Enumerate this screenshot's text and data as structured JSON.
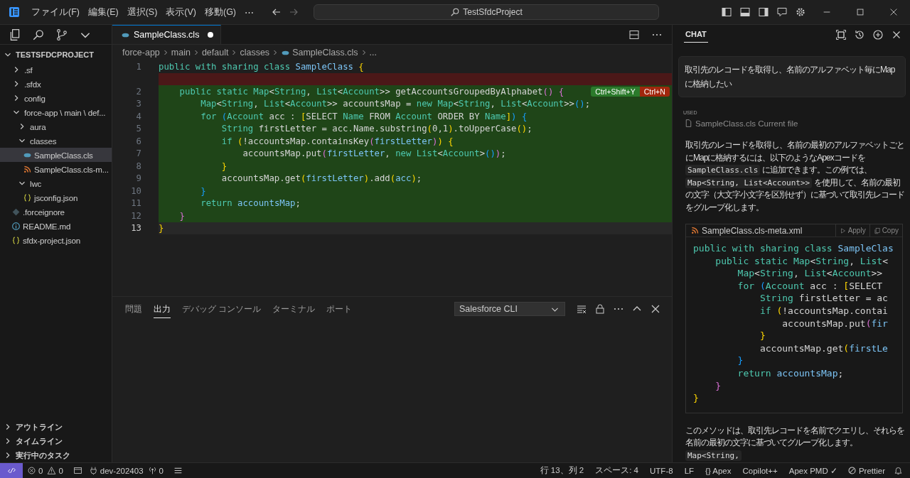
{
  "titlebar": {
    "menus": [
      "ファイル(F)",
      "編集(E)",
      "選択(S)",
      "表示(V)",
      "移動(G)"
    ],
    "overflow": "⋯",
    "search": "TestSfdcProject"
  },
  "explorer": {
    "title": "TESTSFDCPROJECT",
    "items": [
      {
        "label": ".sf",
        "kind": "folder",
        "expanded": false,
        "selected": false
      },
      {
        "label": ".sfdx",
        "kind": "folder",
        "expanded": false,
        "selected": false
      },
      {
        "label": "config",
        "kind": "folder",
        "expanded": false,
        "selected": false
      },
      {
        "label": "force-app \\ main \\ def...",
        "kind": "folder",
        "expanded": true,
        "selected": false,
        "children": [
          {
            "label": "aura",
            "kind": "folder",
            "expanded": false,
            "selected": false
          },
          {
            "label": "classes",
            "kind": "folder",
            "expanded": true,
            "selected": false,
            "children": [
              {
                "label": "SampleClass.cls",
                "kind": "apex",
                "selected": true
              },
              {
                "label": "SampleClass.cls-m...",
                "kind": "xml",
                "selected": false
              }
            ]
          },
          {
            "label": "lwc",
            "kind": "folder",
            "expanded": true,
            "selected": false,
            "children": [
              {
                "label": "jsconfig.json",
                "kind": "json",
                "selected": false
              }
            ]
          }
        ]
      },
      {
        "label": ".forceignore",
        "kind": "ignore",
        "selected": false
      },
      {
        "label": "README.md",
        "kind": "info",
        "selected": false
      },
      {
        "label": "sfdx-project.json",
        "kind": "json",
        "selected": false
      }
    ],
    "sections": [
      "アウトライン",
      "タイムライン",
      "実行中のタスク"
    ]
  },
  "editor": {
    "tabs": [
      {
        "label": "SampleClass.cls",
        "selected": true,
        "modified": true
      }
    ],
    "breadcrumbs": [
      {
        "label": "force-app",
        "kind": "folder"
      },
      {
        "label": "main",
        "kind": "folder"
      },
      {
        "label": "default",
        "kind": "folder"
      },
      {
        "label": "classes",
        "kind": "folder"
      },
      {
        "label": "SampleClass.cls",
        "kind": "apex"
      },
      {
        "label": "...",
        "kind": "more"
      }
    ],
    "lines": [
      {
        "number": "1",
        "kind": "context",
        "tokens": [
          {
            "text": "public with sharing class ",
            "kind": "keyword"
          },
          {
            "text": "SampleClass",
            "kind": "variable"
          },
          {
            "text": " {",
            "kind": "bracket1"
          }
        ]
      },
      {
        "kind": "removed"
      },
      {
        "number": "2",
        "kind": "added",
        "tokens": [
          {
            "text": "    public static Map",
            "kind": "keyword"
          },
          {
            "text": "<"
          },
          {
            "text": "String",
            "kind": "keyword"
          },
          {
            "text": ", "
          },
          {
            "text": "List",
            "kind": "keyword"
          },
          {
            "text": "<"
          },
          {
            "text": "Account",
            "kind": "keyword"
          },
          {
            "text": ">> getAccountsGroupedByAlphabet"
          },
          {
            "text": "()",
            "kind": "bracket2"
          },
          {
            "text": " {",
            "kind": "bracket2"
          }
        ],
        "actions": [
          {
            "label": "Ctrl+Shift+Y",
            "kind": "accept"
          },
          {
            "label": "Ctrl+N",
            "kind": "reject"
          }
        ]
      },
      {
        "number": "3",
        "kind": "added",
        "tokens": [
          {
            "text": "        Map",
            "kind": "keyword"
          },
          {
            "text": "<"
          },
          {
            "text": "String",
            "kind": "keyword"
          },
          {
            "text": ", "
          },
          {
            "text": "List",
            "kind": "keyword"
          },
          {
            "text": "<"
          },
          {
            "text": "Account",
            "kind": "keyword"
          },
          {
            "text": ">> accountsMap = "
          },
          {
            "text": "new Map",
            "kind": "keyword"
          },
          {
            "text": "<"
          },
          {
            "text": "String",
            "kind": "keyword"
          },
          {
            "text": ", "
          },
          {
            "text": "List",
            "kind": "keyword"
          },
          {
            "text": "<"
          },
          {
            "text": "Account",
            "kind": "keyword"
          },
          {
            "text": ">>"
          },
          {
            "text": "()",
            "kind": "bracket3"
          },
          {
            "text": ";"
          }
        ]
      },
      {
        "number": "4",
        "kind": "added",
        "tokens": [
          {
            "text": "        for ",
            "kind": "keyword"
          },
          {
            "text": "(",
            "kind": "bracket3"
          },
          {
            "text": "Account",
            "kind": "keyword"
          },
          {
            "text": " acc : "
          },
          {
            "text": "[",
            "kind": "bracket1"
          },
          {
            "text": "SELECT "
          },
          {
            "text": "Name",
            "kind": "keyword"
          },
          {
            "text": " FROM "
          },
          {
            "text": "Account",
            "kind": "keyword"
          },
          {
            "text": " ORDER BY "
          },
          {
            "text": "Name",
            "kind": "keyword"
          },
          {
            "text": "]",
            "kind": "bracket1"
          },
          {
            "text": ")",
            "kind": "bracket3"
          },
          {
            "text": " {",
            "kind": "bracket3"
          }
        ]
      },
      {
        "number": "5",
        "kind": "added",
        "tokens": [
          {
            "text": "            String",
            "kind": "keyword"
          },
          {
            "text": " firstLetter = acc.Name.substring"
          },
          {
            "text": "(",
            "kind": "bracket1"
          },
          {
            "text": "0,1"
          },
          {
            "text": ")",
            "kind": "bracket1"
          },
          {
            "text": ".toUpperCase"
          },
          {
            "text": "()",
            "kind": "bracket1"
          },
          {
            "text": ";"
          }
        ]
      },
      {
        "number": "6",
        "kind": "added",
        "tokens": [
          {
            "text": "            if ",
            "kind": "keyword"
          },
          {
            "text": "(",
            "kind": "bracket1"
          },
          {
            "text": "!accountsMap.containsKey"
          },
          {
            "text": "(",
            "kind": "bracket2"
          },
          {
            "text": "firstLetter",
            "kind": "variable"
          },
          {
            "text": ")",
            "kind": "bracket2"
          },
          {
            "text": ")",
            "kind": "bracket1"
          },
          {
            "text": " {",
            "kind": "bracket1"
          }
        ]
      },
      {
        "number": "7",
        "kind": "added",
        "tokens": [
          {
            "text": "                accountsMap.put"
          },
          {
            "text": "(",
            "kind": "bracket2"
          },
          {
            "text": "firstLetter",
            "kind": "variable"
          },
          {
            "text": ", "
          },
          {
            "text": "new List",
            "kind": "keyword"
          },
          {
            "text": "<"
          },
          {
            "text": "Account",
            "kind": "keyword"
          },
          {
            "text": ">"
          },
          {
            "text": "()",
            "kind": "bracket3"
          },
          {
            "text": ")",
            "kind": "bracket2"
          },
          {
            "text": ";"
          }
        ]
      },
      {
        "number": "8",
        "kind": "added",
        "tokens": [
          {
            "text": "            }",
            "kind": "bracket1"
          }
        ]
      },
      {
        "number": "9",
        "kind": "added",
        "tokens": [
          {
            "text": "            accountsMap.get"
          },
          {
            "text": "(",
            "kind": "bracket1"
          },
          {
            "text": "firstLetter",
            "kind": "variable"
          },
          {
            "text": ")",
            "kind": "bracket1"
          },
          {
            "text": ".add"
          },
          {
            "text": "(",
            "kind": "bracket1"
          },
          {
            "text": "acc",
            "kind": "variable"
          },
          {
            "text": ")",
            "kind": "bracket1"
          },
          {
            "text": ";"
          }
        ]
      },
      {
        "number": "10",
        "kind": "added",
        "tokens": [
          {
            "text": "        }",
            "kind": "bracket3"
          }
        ]
      },
      {
        "number": "11",
        "kind": "added",
        "tokens": [
          {
            "text": "        return ",
            "kind": "keyword"
          },
          {
            "text": "accountsMap",
            "kind": "variable"
          },
          {
            "text": ";"
          }
        ]
      },
      {
        "number": "12",
        "kind": "added",
        "tokens": [
          {
            "text": "    }",
            "kind": "bracket2"
          }
        ]
      },
      {
        "number": "13",
        "kind": "current",
        "tokens": [
          {
            "text": "}",
            "kind": "bracket1"
          }
        ]
      }
    ]
  },
  "panel": {
    "tabs": [
      {
        "label": "問題",
        "selected": false
      },
      {
        "label": "出力",
        "selected": true
      },
      {
        "label": "デバッグ コンソール",
        "selected": false
      },
      {
        "label": "ターミナル",
        "selected": false
      },
      {
        "label": "ポート",
        "selected": false
      }
    ],
    "dropdown": "Salesforce CLI"
  },
  "chat": {
    "title": "CHAT",
    "request": "取引先のレコードを取得し、名前のアルファベット毎にMapに格納したい",
    "used_label": "USED",
    "used_file": "SampleClass.cls Current file",
    "answer": [
      {
        "text": "取引先のレコードを取得し、名前の最初のアルファベットごとにMapに格納するには、以下のようなApexコードを ",
        "kind": "text"
      },
      {
        "text": "SampleClass.cls",
        "kind": "code"
      },
      {
        "text": " に追加できます。この例では、",
        "kind": "text"
      },
      {
        "text": "Map<String, List<Account>>",
        "kind": "code"
      },
      {
        "text": " を使用して、名前の最初の文字（大文字小文字を区別せず）に基づいて取引先レコードをグループ化します。",
        "kind": "text"
      }
    ],
    "code_block": {
      "file": "SampleClass.cls-meta.xml",
      "buttons": [
        "Apply",
        "Copy"
      ],
      "lines": [
        [
          {
            "text": "public with sharing class ",
            "kind": "keyword"
          },
          {
            "text": "SampleClas",
            "kind": "variable"
          }
        ],
        [
          {
            "text": "    public static Map",
            "kind": "keyword"
          },
          {
            "text": "<"
          },
          {
            "text": "String",
            "kind": "keyword"
          },
          {
            "text": ", "
          },
          {
            "text": "List",
            "kind": "keyword"
          },
          {
            "text": "<"
          }
        ],
        [
          {
            "text": "        Map",
            "kind": "keyword"
          },
          {
            "text": "<"
          },
          {
            "text": "String",
            "kind": "keyword"
          },
          {
            "text": ", "
          },
          {
            "text": "List",
            "kind": "keyword"
          },
          {
            "text": "<"
          },
          {
            "text": "Account",
            "kind": "keyword"
          },
          {
            "text": ">>"
          }
        ],
        [
          {
            "text": "        for ",
            "kind": "keyword"
          },
          {
            "text": "(",
            "kind": "bracket3"
          },
          {
            "text": "Account",
            "kind": "keyword"
          },
          {
            "text": " acc : "
          },
          {
            "text": "[",
            "kind": "bracket1"
          },
          {
            "text": "SELECT"
          }
        ],
        [
          {
            "text": "            String",
            "kind": "keyword"
          },
          {
            "text": " firstLetter = ac"
          }
        ],
        [
          {
            "text": "            if ",
            "kind": "keyword"
          },
          {
            "text": "(",
            "kind": "bracket1"
          },
          {
            "text": "!accountsMap.contai"
          }
        ],
        [
          {
            "text": "                accountsMap.put"
          },
          {
            "text": "(",
            "kind": "bracket2"
          },
          {
            "text": "fir",
            "kind": "variable"
          }
        ],
        [
          {
            "text": "            }",
            "kind": "bracket1"
          }
        ],
        [
          {
            "text": "            accountsMap.get"
          },
          {
            "text": "(",
            "kind": "bracket1"
          },
          {
            "text": "firstLe",
            "kind": "variable"
          }
        ],
        [
          {
            "text": "        }",
            "kind": "bracket3"
          }
        ],
        [
          {
            "text": "        return ",
            "kind": "keyword"
          },
          {
            "text": "accountsMap",
            "kind": "variable"
          },
          {
            "text": ";"
          }
        ],
        [
          {
            "text": "    }",
            "kind": "bracket2"
          }
        ],
        [
          {
            "text": "}",
            "kind": "bracket1"
          }
        ]
      ]
    },
    "followup": [
      {
        "text": "このメソッドは、取引先レコードを名前でクエリし、それらを名前の最初の文字に基づいてグループ化します。",
        "kind": "text"
      },
      {
        "text": "Map<String,",
        "kind": "code"
      }
    ]
  },
  "status_bar": {
    "left": [
      {
        "text": "0",
        "kind": "errors"
      },
      {
        "text": "0",
        "kind": "warnings"
      },
      {
        "text": "dev-202403",
        "kind": "branch"
      },
      {
        "text": "0",
        "kind": "ports"
      }
    ],
    "right": [
      "行 13、列 2",
      "スペース: 4",
      "UTF-8",
      "LF",
      "{} Apex",
      "Copilot++",
      "Apex PMD ✓"
    ],
    "prettier": "Prettier"
  }
}
